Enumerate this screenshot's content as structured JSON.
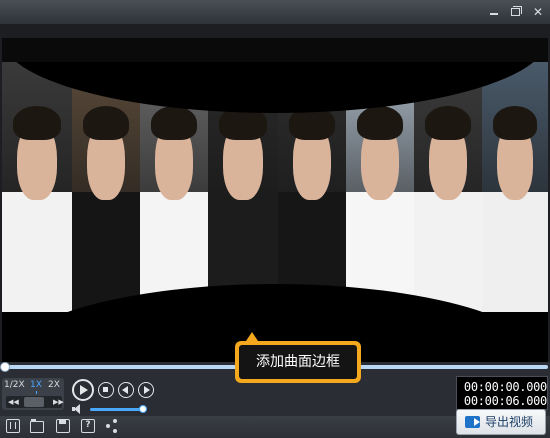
{
  "window": {
    "icons": [
      "minimize-icon",
      "maximize-icon",
      "close-icon"
    ]
  },
  "tooltip": {
    "text": "添加曲面边框",
    "border_color": "#f4a81d"
  },
  "playback": {
    "speeds": [
      "1/2X",
      "1X",
      "2X"
    ],
    "active_speed": "1X",
    "volume_level": 1.0,
    "seek_position": 0.0,
    "current_time": "00:00:00.000",
    "total_time": "00:00:06.000"
  },
  "toolbar": {
    "icons": [
      "film-icon",
      "open-folder-icon",
      "save-icon",
      "help-icon",
      "share-icon"
    ],
    "export_label": "导出视频"
  },
  "colors": {
    "accent": "#4aa8ff",
    "background": "#2a2d33"
  }
}
